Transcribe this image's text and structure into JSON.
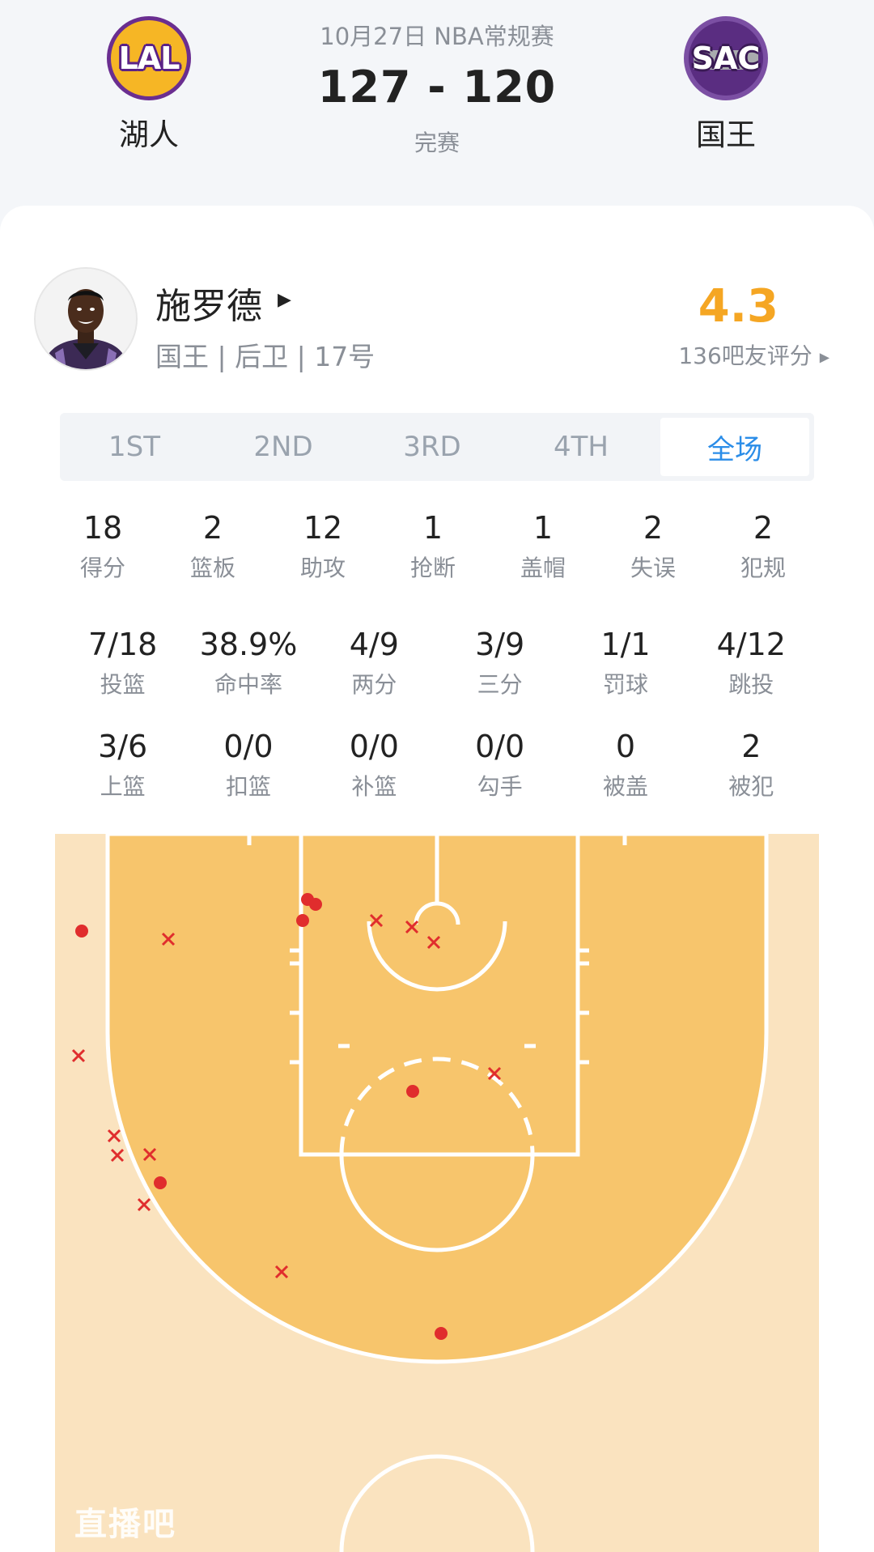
{
  "game": {
    "date": "10月27日 NBA常规赛",
    "score": "127 - 120",
    "status": "完赛",
    "home": {
      "abbr": "LAL",
      "name": "湖人",
      "logo_color": "#f6b625",
      "logo_accent": "#5b2286"
    },
    "away": {
      "abbr": "SAC",
      "name": "国王",
      "logo_color": "#5a2d81",
      "logo_accent": "#a9abae"
    }
  },
  "player": {
    "name": "施罗德",
    "meta": "国王 | 后卫 | 17号",
    "rating": "4.3",
    "rating_count": "136吧友评分"
  },
  "tabs": [
    {
      "label": "1ST",
      "active": false
    },
    {
      "label": "2ND",
      "active": false
    },
    {
      "label": "3RD",
      "active": false
    },
    {
      "label": "4TH",
      "active": false
    },
    {
      "label": "全场",
      "active": true
    }
  ],
  "stats_row1": [
    {
      "value": "18",
      "label": "得分"
    },
    {
      "value": "2",
      "label": "篮板"
    },
    {
      "value": "12",
      "label": "助攻"
    },
    {
      "value": "1",
      "label": "抢断"
    },
    {
      "value": "1",
      "label": "盖帽"
    },
    {
      "value": "2",
      "label": "失误"
    },
    {
      "value": "2",
      "label": "犯规"
    }
  ],
  "stats_row2": [
    {
      "value": "7/18",
      "label": "投篮"
    },
    {
      "value": "38.9%",
      "label": "命中率"
    },
    {
      "value": "4/9",
      "label": "两分"
    },
    {
      "value": "3/9",
      "label": "三分"
    },
    {
      "value": "1/1",
      "label": "罚球"
    },
    {
      "value": "4/12",
      "label": "跳投"
    }
  ],
  "stats_row3": [
    {
      "value": "3/6",
      "label": "上篮"
    },
    {
      "value": "0/0",
      "label": "扣篮"
    },
    {
      "value": "0/0",
      "label": "补篮"
    },
    {
      "value": "0/0",
      "label": "勾手"
    },
    {
      "value": "0",
      "label": "被盖"
    },
    {
      "value": "2",
      "label": "被犯"
    }
  ],
  "shot_chart": {
    "colors": {
      "made": "#e02d2d",
      "missed": "#e02d2d",
      "paint": "#f7c56c",
      "outside": "#fae3bf"
    },
    "shots": [
      {
        "result": "made"
      },
      {
        "result": "made"
      },
      {
        "result": "made"
      },
      {
        "result": "missed"
      },
      {
        "result": "missed"
      },
      {
        "result": "missed"
      },
      {
        "result": "made"
      },
      {
        "result": "missed"
      },
      {
        "result": "missed"
      },
      {
        "result": "missed"
      },
      {
        "result": "missed"
      },
      {
        "result": "missed"
      },
      {
        "result": "missed"
      },
      {
        "result": "missed"
      },
      {
        "result": "made"
      },
      {
        "result": "made"
      },
      {
        "result": "missed"
      },
      {
        "result": "made"
      }
    ]
  },
  "watermark": "直播吧"
}
